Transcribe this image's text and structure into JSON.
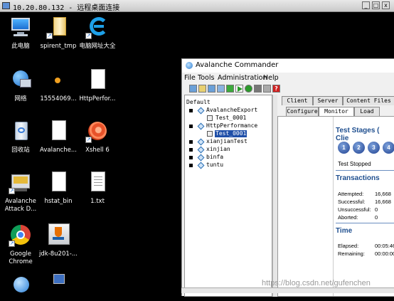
{
  "rdp": {
    "title": "10.20.80.132 - 远程桌面连接",
    "min": "_",
    "max": "□",
    "close": "x"
  },
  "desktop": {
    "icons": [
      {
        "label": "此电脑",
        "icon": "computer-icon"
      },
      {
        "label": "spirent_tmp",
        "icon": "folder-icon"
      },
      {
        "label": "电脑网址大全",
        "icon": "ie-icon"
      },
      {
        "label": "网络",
        "icon": "network-icon"
      },
      {
        "label": "15554069...",
        "icon": "image-file-icon"
      },
      {
        "label": "HttpPerfor...",
        "icon": "document-icon"
      },
      {
        "label": "回收站",
        "icon": "recycle-bin-icon"
      },
      {
        "label": "Avalanche...",
        "icon": "document-icon"
      },
      {
        "label": "Xshell 6",
        "icon": "xshell-icon"
      },
      {
        "label": "Avalanche Attack D...",
        "icon": "avalanche-icon"
      },
      {
        "label": "hstat_bin",
        "icon": "document-icon"
      },
      {
        "label": "1.txt",
        "icon": "text-file-icon"
      },
      {
        "label": "Google Chrome",
        "icon": "chrome-icon"
      },
      {
        "label": "jdk-8u201-...",
        "icon": "java-installer-icon"
      }
    ]
  },
  "app": {
    "title": "Avalanche Commander",
    "menu": [
      "File",
      "Tools",
      "Administration",
      "Help"
    ],
    "tree": {
      "root": "Default",
      "items": [
        {
          "label": "AvalancheExport",
          "child": "Test_0001"
        },
        {
          "label": "HttpPerformance",
          "child": "Test_0001"
        },
        {
          "label": "xianjianTest"
        },
        {
          "label": "xinjian"
        },
        {
          "label": "binfa"
        },
        {
          "label": "tuntu"
        }
      ]
    },
    "tabs_top": [
      "Client",
      "Server",
      "Content Files"
    ],
    "tabs_bottom": [
      "Configure",
      "Monitor",
      "Load"
    ],
    "monitor": {
      "stages_title": "Test Stages ( Clie",
      "stages": [
        "1",
        "2",
        "3",
        "4"
      ],
      "status": "Test Stopped",
      "transactions_title": "Transactions",
      "transactions": [
        {
          "k": "Attempted:",
          "v": "16,668"
        },
        {
          "k": "Successful:",
          "v": "16,668"
        },
        {
          "k": "Unsuccessful:",
          "v": "0"
        },
        {
          "k": "Aborted:",
          "v": "0"
        }
      ],
      "time_title": "Time",
      "time": [
        {
          "k": "Elapsed:",
          "v": "00:05:46"
        },
        {
          "k": "Remaining:",
          "v": "00:00:00"
        }
      ]
    }
  },
  "watermark": "https://blog.csdn.net/gufenchen"
}
